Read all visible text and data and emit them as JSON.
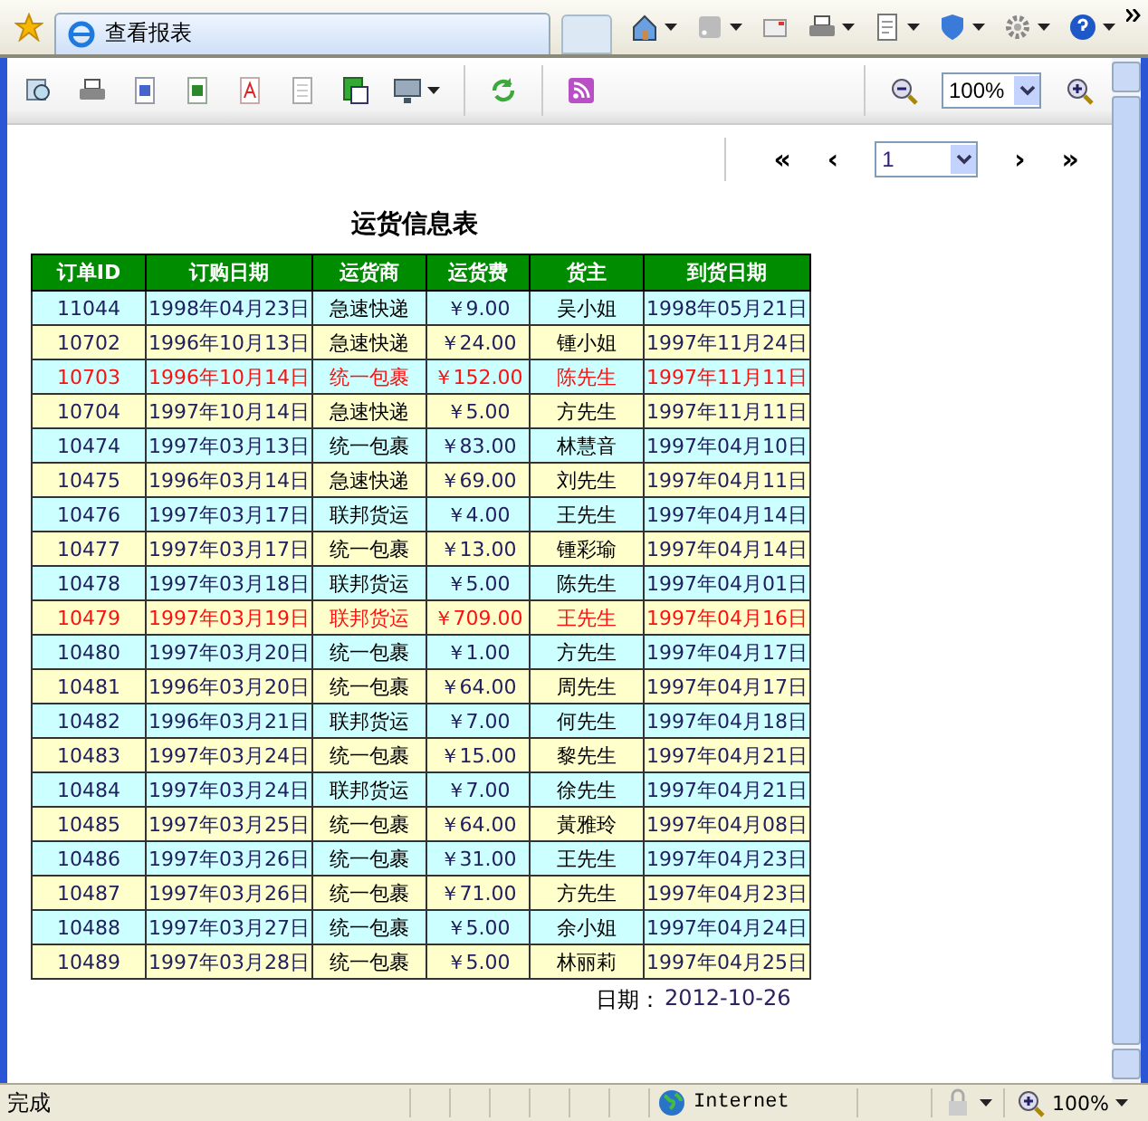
{
  "browser": {
    "tab_title": "查看报表",
    "status": "完成",
    "zone": "Internet",
    "zoom": "100%"
  },
  "toolbar": {
    "zoom_select": "100%"
  },
  "pager": {
    "first": "«",
    "prev": "‹",
    "page": "1",
    "next": "›",
    "last": "»"
  },
  "report": {
    "title": "运货信息表",
    "columns": [
      "订单ID",
      "订购日期",
      "运货商",
      "运货费",
      "货主",
      "到货日期"
    ],
    "rows": [
      {
        "cells": [
          "11044",
          "1998年04月23日",
          "急速快递",
          "￥9.00",
          "吴小姐",
          "1998年05月21日"
        ],
        "highlight": false
      },
      {
        "cells": [
          "10702",
          "1996年10月13日",
          "急速快递",
          "￥24.00",
          "锺小姐",
          "1997年11月24日"
        ],
        "highlight": false
      },
      {
        "cells": [
          "10703",
          "1996年10月14日",
          "统一包裹",
          "￥152.00",
          "陈先生",
          "1997年11月11日"
        ],
        "highlight": true
      },
      {
        "cells": [
          "10704",
          "1997年10月14日",
          "急速快递",
          "￥5.00",
          "方先生",
          "1997年11月11日"
        ],
        "highlight": false
      },
      {
        "cells": [
          "10474",
          "1997年03月13日",
          "统一包裹",
          "￥83.00",
          "林慧音",
          "1997年04月10日"
        ],
        "highlight": false
      },
      {
        "cells": [
          "10475",
          "1996年03月14日",
          "急速快递",
          "￥69.00",
          "刘先生",
          "1997年04月11日"
        ],
        "highlight": false
      },
      {
        "cells": [
          "10476",
          "1997年03月17日",
          "联邦货运",
          "￥4.00",
          "王先生",
          "1997年04月14日"
        ],
        "highlight": false
      },
      {
        "cells": [
          "10477",
          "1997年03月17日",
          "统一包裹",
          "￥13.00",
          "锺彩瑜",
          "1997年04月14日"
        ],
        "highlight": false
      },
      {
        "cells": [
          "10478",
          "1997年03月18日",
          "联邦货运",
          "￥5.00",
          "陈先生",
          "1997年04月01日"
        ],
        "highlight": false
      },
      {
        "cells": [
          "10479",
          "1997年03月19日",
          "联邦货运",
          "￥709.00",
          "王先生",
          "1997年04月16日"
        ],
        "highlight": true
      },
      {
        "cells": [
          "10480",
          "1997年03月20日",
          "统一包裹",
          "￥1.00",
          "方先生",
          "1997年04月17日"
        ],
        "highlight": false
      },
      {
        "cells": [
          "10481",
          "1996年03月20日",
          "统一包裹",
          "￥64.00",
          "周先生",
          "1997年04月17日"
        ],
        "highlight": false
      },
      {
        "cells": [
          "10482",
          "1996年03月21日",
          "联邦货运",
          "￥7.00",
          "何先生",
          "1997年04月18日"
        ],
        "highlight": false
      },
      {
        "cells": [
          "10483",
          "1997年03月24日",
          "统一包裹",
          "￥15.00",
          "黎先生",
          "1997年04月21日"
        ],
        "highlight": false
      },
      {
        "cells": [
          "10484",
          "1997年03月24日",
          "联邦货运",
          "￥7.00",
          "徐先生",
          "1997年04月21日"
        ],
        "highlight": false
      },
      {
        "cells": [
          "10485",
          "1997年03月25日",
          "统一包裹",
          "￥64.00",
          "黃雅玲",
          "1997年04月08日"
        ],
        "highlight": false
      },
      {
        "cells": [
          "10486",
          "1997年03月26日",
          "统一包裹",
          "￥31.00",
          "王先生",
          "1997年04月23日"
        ],
        "highlight": false
      },
      {
        "cells": [
          "10487",
          "1997年03月26日",
          "统一包裹",
          "￥71.00",
          "方先生",
          "1997年04月23日"
        ],
        "highlight": false
      },
      {
        "cells": [
          "10488",
          "1997年03月27日",
          "统一包裹",
          "￥5.00",
          "余小姐",
          "1997年04月24日"
        ],
        "highlight": false
      },
      {
        "cells": [
          "10489",
          "1997年03月28日",
          "统一包裹",
          "￥5.00",
          "林丽莉",
          "1997年04月25日"
        ],
        "highlight": false
      }
    ],
    "date_label": "日期：",
    "date_value": "2012-10-26"
  }
}
